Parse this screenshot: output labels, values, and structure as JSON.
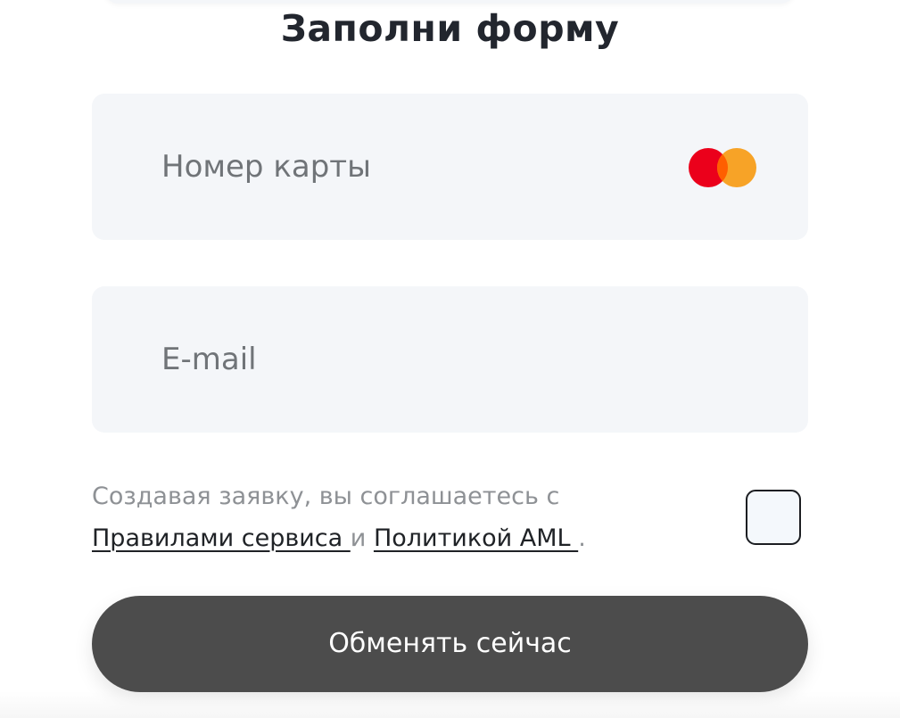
{
  "form": {
    "title": "Заполни форму",
    "card_field": {
      "placeholder": "Номер карты",
      "brand_icon": "mastercard-icon",
      "brand_colors": {
        "left": "#eb001b",
        "right": "#f79e1b"
      }
    },
    "email_field": {
      "placeholder": "E-mail"
    },
    "consent": {
      "prefix": "Создавая заявку, вы соглашаетесь с",
      "rules_link": "Правилами сервиса ",
      "conjunction": "и",
      "aml_link": "Политикой AML ",
      "suffix": ".",
      "checkbox_checked": false
    },
    "submit_label": "Обменять сейчас"
  },
  "colors": {
    "field_background": "#f4f6f9",
    "button_background": "#4c4c4c",
    "title_text": "#22262e",
    "muted_text": "#8e9195"
  }
}
